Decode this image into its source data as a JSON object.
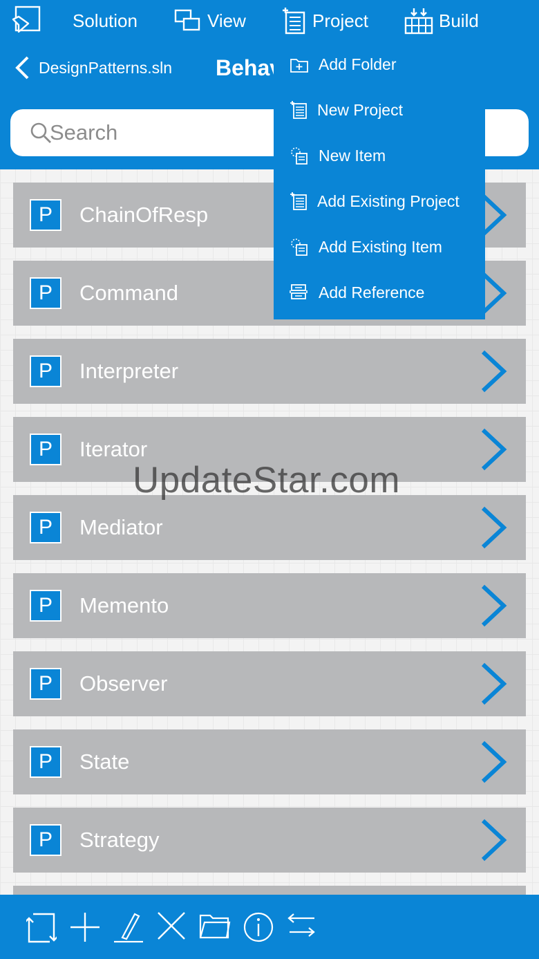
{
  "menubar": {
    "items": [
      {
        "label": "Solution",
        "icon": "solution-window-icon"
      },
      {
        "label": "View",
        "icon": "view-windows-icon"
      },
      {
        "label": "Project",
        "icon": "project-document-icon"
      },
      {
        "label": "Build",
        "icon": "build-grid-icon"
      }
    ]
  },
  "nav": {
    "back_label": "DesignPatterns.sln",
    "title": "Behav"
  },
  "search": {
    "placeholder": "Search"
  },
  "project_menu": {
    "items": [
      {
        "label": "Add Folder",
        "icon": "add-folder-icon"
      },
      {
        "label": "New Project",
        "icon": "new-project-icon"
      },
      {
        "label": "New Item",
        "icon": "new-item-icon"
      },
      {
        "label": "Add Existing Project",
        "icon": "existing-project-icon"
      },
      {
        "label": "Add Existing Item",
        "icon": "existing-item-icon"
      },
      {
        "label": "Add Reference",
        "icon": "reference-icon"
      }
    ]
  },
  "projects": {
    "badge": "P",
    "items": [
      {
        "name": "ChainOfResp"
      },
      {
        "name": "Command"
      },
      {
        "name": "Interpreter"
      },
      {
        "name": "Iterator"
      },
      {
        "name": "Mediator"
      },
      {
        "name": "Memento"
      },
      {
        "name": "Observer"
      },
      {
        "name": "State"
      },
      {
        "name": "Strategy"
      }
    ]
  },
  "watermark": "UpdateStar.com",
  "toolbar": {
    "icons": [
      "rotate-icon",
      "add-icon",
      "edit-pencil-icon",
      "delete-x-icon",
      "folder-icon",
      "info-icon",
      "swap-icon"
    ]
  },
  "colors": {
    "accent": "#0a85d6",
    "row": "#b7b8ba",
    "background": "#f3f3f3"
  }
}
